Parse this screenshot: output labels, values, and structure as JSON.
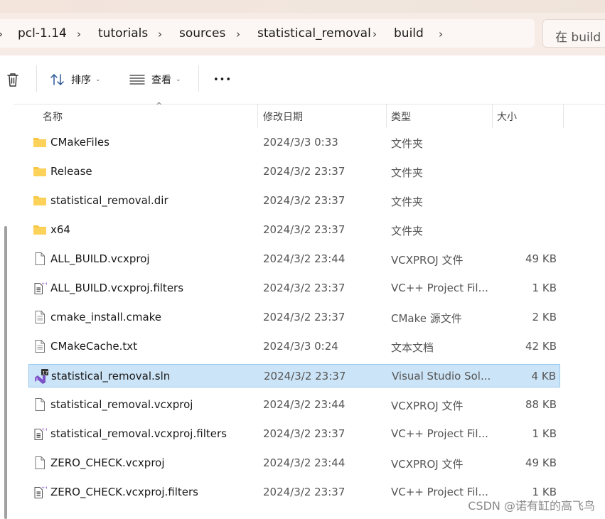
{
  "breadcrumb": {
    "items": [
      "pcl-1.14",
      "tutorials",
      "sources",
      "statistical_removal",
      "build"
    ]
  },
  "search": {
    "placeholder": "在 build"
  },
  "toolbar": {
    "sort_label": "排序",
    "view_label": "查看",
    "more_label": "•••"
  },
  "columns": {
    "name": "名称",
    "date": "修改日期",
    "type": "类型",
    "size": "大小"
  },
  "files": [
    {
      "name": "CMakeFiles",
      "date": "2024/3/3 0:33",
      "type": "文件夹",
      "size": "",
      "icon": "folder-icon"
    },
    {
      "name": "Release",
      "date": "2024/3/2 23:37",
      "type": "文件夹",
      "size": "",
      "icon": "folder-icon"
    },
    {
      "name": "statistical_removal.dir",
      "date": "2024/3/2 23:37",
      "type": "文件夹",
      "size": "",
      "icon": "folder-icon"
    },
    {
      "name": "x64",
      "date": "2024/3/2 23:37",
      "type": "文件夹",
      "size": "",
      "icon": "folder-icon"
    },
    {
      "name": "ALL_BUILD.vcxproj",
      "date": "2024/3/2 23:44",
      "type": "VCXPROJ 文件",
      "size": "49 KB",
      "icon": "file-icon"
    },
    {
      "name": "ALL_BUILD.vcxproj.filters",
      "date": "2024/3/2 23:37",
      "type": "VC++ Project Fil...",
      "size": "1 KB",
      "icon": "vc-filters-icon"
    },
    {
      "name": "cmake_install.cmake",
      "date": "2024/3/2 23:37",
      "type": "CMake 源文件",
      "size": "2 KB",
      "icon": "text-file-icon"
    },
    {
      "name": "CMakeCache.txt",
      "date": "2024/3/3 0:24",
      "type": "文本文档",
      "size": "42 KB",
      "icon": "text-file-icon"
    },
    {
      "name": "statistical_removal.sln",
      "date": "2024/3/2 23:37",
      "type": "Visual Studio Sol...",
      "size": "4 KB",
      "icon": "visual-studio-icon",
      "selected": true
    },
    {
      "name": "statistical_removal.vcxproj",
      "date": "2024/3/2 23:44",
      "type": "VCXPROJ 文件",
      "size": "88 KB",
      "icon": "file-icon"
    },
    {
      "name": "statistical_removal.vcxproj.filters",
      "date": "2024/3/2 23:37",
      "type": "VC++ Project Fil...",
      "size": "1 KB",
      "icon": "vc-filters-icon"
    },
    {
      "name": "ZERO_CHECK.vcxproj",
      "date": "2024/3/2 23:44",
      "type": "VCXPROJ 文件",
      "size": "49 KB",
      "icon": "file-icon"
    },
    {
      "name": "ZERO_CHECK.vcxproj.filters",
      "date": "2024/3/2 23:37",
      "type": "VC++ Project Fil...",
      "size": "1 KB",
      "icon": "vc-filters-icon"
    }
  ],
  "watermark": "CSDN @诺有缸的高飞鸟",
  "colors": {
    "selection_bg": "#cce4f7",
    "selection_border": "#99c9ef",
    "folder": "#f7c744",
    "address_bar_bg": "#f6ebe5"
  }
}
